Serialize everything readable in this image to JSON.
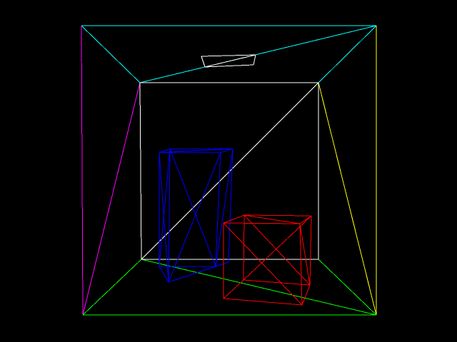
{
  "scene": {
    "background": "#000000",
    "render_mode": "wireframe",
    "objects": [
      {
        "name": "ceiling-wireframe",
        "color": "#00ffff",
        "edge_count": 4
      },
      {
        "name": "left-wall-wireframe",
        "color": "#ff00ff",
        "edge_count": 3
      },
      {
        "name": "right-wall-wireframe",
        "color": "#ffff00",
        "edge_count": 3
      },
      {
        "name": "floor-wireframe",
        "color": "#00ff00",
        "edge_count": 4
      },
      {
        "name": "back-wall-wireframe",
        "color": "#ffffff",
        "edge_count": 5
      },
      {
        "name": "ceiling-light-wireframe",
        "color": "#ffffff",
        "edge_count": 5
      },
      {
        "name": "tall-box-wireframe",
        "color": "#0000ff",
        "edge_count": 18
      },
      {
        "name": "short-box-wireframe",
        "color": "#ff0000",
        "edge_count": 18
      }
    ]
  }
}
